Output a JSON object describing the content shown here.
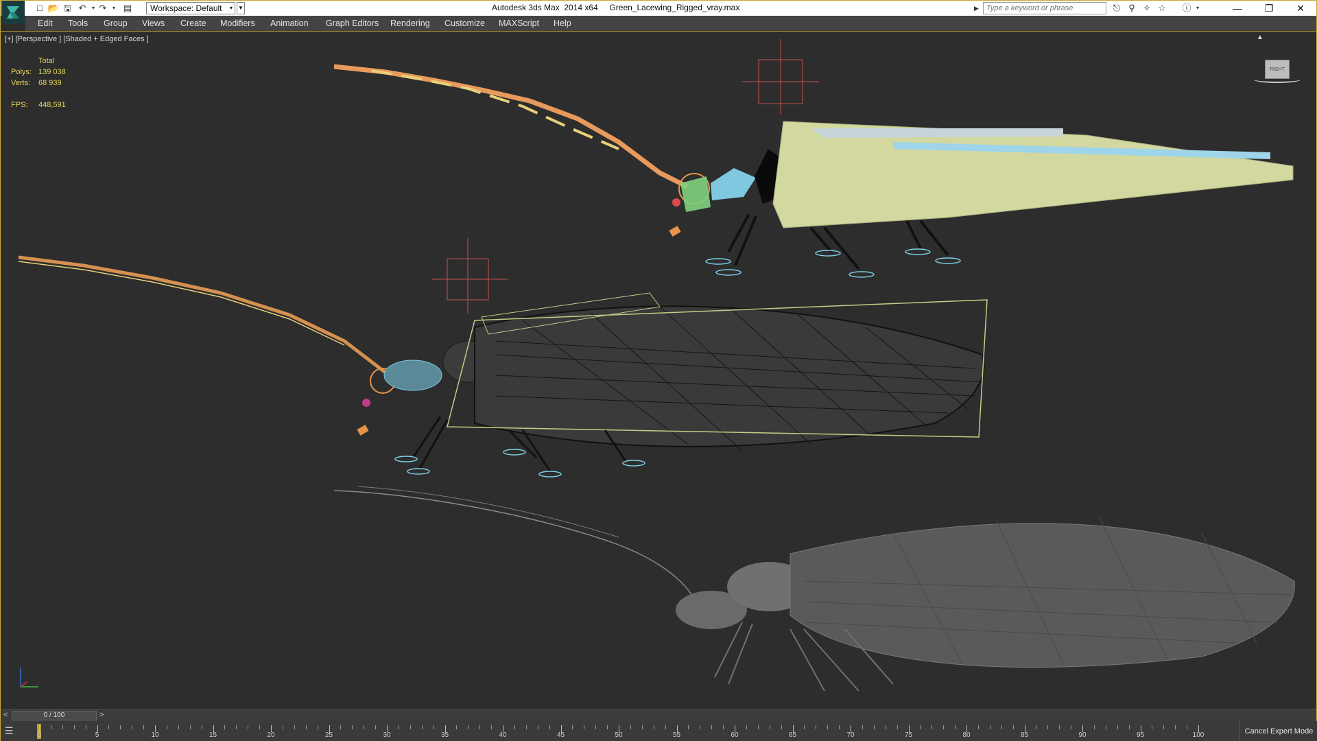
{
  "titlebar": {
    "workspace_label": "Workspace: Default",
    "window_title": "Autodesk 3ds Max  2014 x64     Green_Lacewing_Rigged_vray.max",
    "search_placeholder": "Type a keyword or phrase",
    "quick_access_icons": [
      "new-file-icon",
      "open-file-icon",
      "save-icon",
      "undo-icon",
      "redo-icon",
      "project-icon"
    ],
    "tool_icons": [
      "binoculars-icon",
      "communication-center-icon",
      "favorites-icon",
      "star-icon",
      "help-icon"
    ],
    "window_buttons": [
      "minimize-icon",
      "restore-icon",
      "close-icon"
    ]
  },
  "menu": {
    "items": [
      "Edit",
      "Tools",
      "Group",
      "Views",
      "Create",
      "Modifiers",
      "Animation",
      "Graph Editors",
      "Rendering",
      "Customize",
      "MAXScript",
      "Help"
    ]
  },
  "viewport": {
    "label": "[+] [Perspective ] [Shaded + Edged Faces ]",
    "stats": {
      "header": "Total",
      "polys_label": "Polys:",
      "polys_value": "139 038",
      "verts_label": "Verts:",
      "verts_value": "68 939",
      "fps_label": "FPS:",
      "fps_value": "448,591"
    },
    "viewcube_label": "RIGHT"
  },
  "timeline": {
    "frame_display": "0 / 100",
    "prev_symbol": "<",
    "next_symbol": ">",
    "current_frame": 0,
    "tick_labels": [
      "0",
      "5",
      "10",
      "15",
      "20",
      "25",
      "30",
      "35",
      "40",
      "45",
      "50",
      "55",
      "60",
      "65",
      "70",
      "75",
      "80",
      "85",
      "90",
      "95",
      "100"
    ]
  },
  "status": {
    "cancel_expert_label": "Cancel Expert Mode"
  },
  "colors": {
    "accent": "#c8a63a",
    "viewport_bg": "#2d2d2d",
    "menubar_bg": "#444444",
    "stats_text": "#e9d55a"
  }
}
